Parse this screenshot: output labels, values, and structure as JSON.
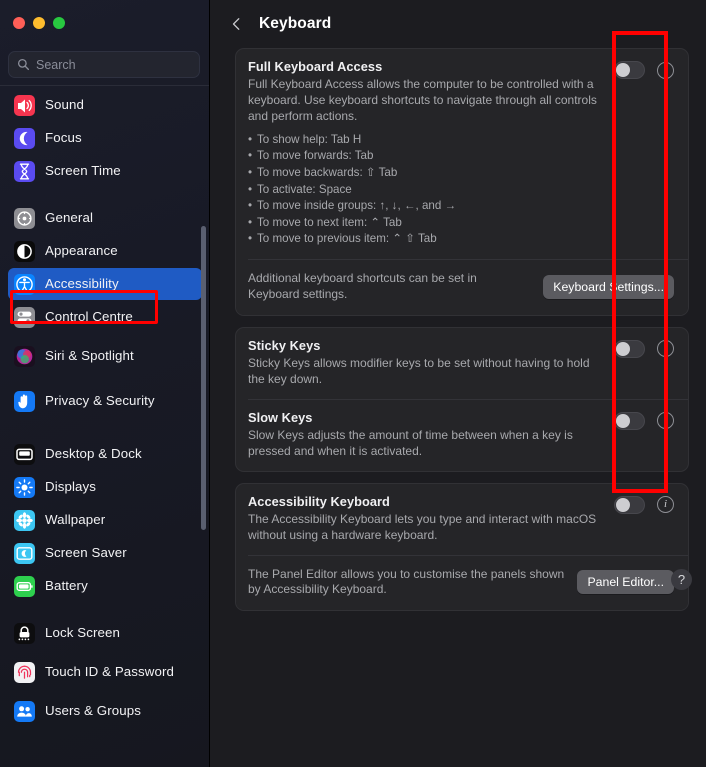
{
  "window": {
    "traffic_lights": [
      "close",
      "minimize",
      "zoom"
    ],
    "colors": {
      "accent_blue": "#1f5bc4",
      "annotation_red": "#ff0000",
      "card_bg": "#252528",
      "window_bg": "#1c1c20"
    }
  },
  "sidebar": {
    "search": {
      "placeholder": "Search",
      "value": "",
      "icon": "search-icon"
    },
    "groups": [
      {
        "items": [
          {
            "label": "Sound",
            "icon": "sound-icon",
            "selected": false
          },
          {
            "label": "Focus",
            "icon": "focus-icon",
            "selected": false
          },
          {
            "label": "Screen Time",
            "icon": "screen-time-icon",
            "selected": false
          }
        ]
      },
      {
        "items": [
          {
            "label": "General",
            "icon": "general-gear-icon",
            "selected": false
          },
          {
            "label": "Appearance",
            "icon": "appearance-icon",
            "selected": false
          },
          {
            "label": "Accessibility",
            "icon": "accessibility-icon",
            "selected": true
          },
          {
            "label": "Control Centre",
            "icon": "control-centre-icon",
            "selected": false
          },
          {
            "label": "Siri & Spotlight",
            "icon": "siri-icon",
            "selected": false
          },
          {
            "label": "Privacy & Security",
            "icon": "privacy-hand-icon",
            "selected": false
          }
        ]
      },
      {
        "items": [
          {
            "label": "Desktop & Dock",
            "icon": "desktop-dock-icon",
            "selected": false
          },
          {
            "label": "Displays",
            "icon": "displays-icon",
            "selected": false
          },
          {
            "label": "Wallpaper",
            "icon": "wallpaper-icon",
            "selected": false
          },
          {
            "label": "Screen Saver",
            "icon": "screen-saver-icon",
            "selected": false
          },
          {
            "label": "Battery",
            "icon": "battery-icon",
            "selected": false
          }
        ]
      },
      {
        "items": [
          {
            "label": "Lock Screen",
            "icon": "lock-screen-icon",
            "selected": false
          },
          {
            "label": "Touch ID & Password",
            "icon": "touch-id-icon",
            "selected": false
          },
          {
            "label": "Users & Groups",
            "icon": "users-groups-icon",
            "selected": false
          }
        ]
      }
    ]
  },
  "header": {
    "back_label": "‹",
    "title": "Keyboard"
  },
  "cards": {
    "full_keyboard_access": {
      "title": "Full Keyboard Access",
      "description": "Full Keyboard Access allows the computer to be controlled with a keyboard. Use keyboard shortcuts to navigate through all controls and perform actions.",
      "bullets": [
        "To show help: Tab H",
        "To move forwards: Tab",
        "To move backwards: ⇧ Tab",
        "To activate: Space",
        "To move inside groups: ↑, ↓, ←, and →",
        "To move to next item: ⌃ Tab",
        "To move to previous item: ⌃ ⇧ Tab"
      ],
      "toggle_state": "off",
      "info_label": "i",
      "footer_text": "Additional keyboard shortcuts can be set in Keyboard settings.",
      "footer_button": "Keyboard Settings..."
    },
    "sticky_keys": {
      "title": "Sticky Keys",
      "description": "Sticky Keys allows modifier keys to be set without having to hold the key down.",
      "toggle_state": "off",
      "info_label": "i"
    },
    "slow_keys": {
      "title": "Slow Keys",
      "description": "Slow Keys adjusts the amount of time between when a key is pressed and when it is activated.",
      "toggle_state": "off",
      "info_label": "i"
    },
    "accessibility_keyboard": {
      "title": "Accessibility Keyboard",
      "description": "The Accessibility Keyboard lets you type and interact with macOS without using a hardware keyboard.",
      "toggle_state": "off",
      "info_label": "i",
      "footer_text": "The Panel Editor allows you to customise the panels shown by Accessibility Keyboard.",
      "footer_button": "Panel Editor..."
    }
  },
  "help": {
    "label": "?"
  }
}
